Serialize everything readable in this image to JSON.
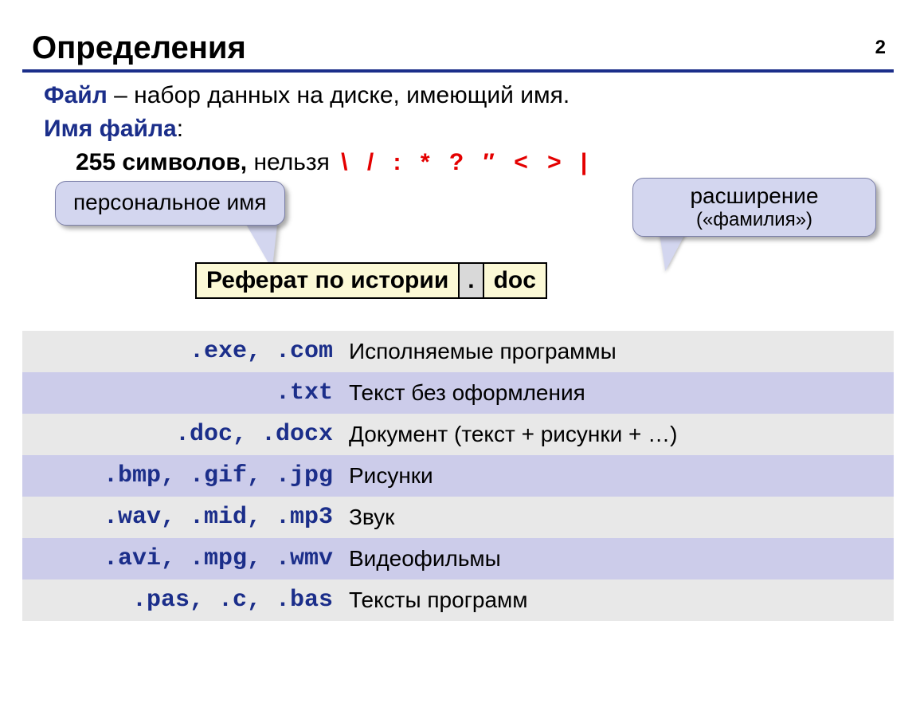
{
  "pageNumber": "2",
  "title": "Определения",
  "def": {
    "term1": "Файл",
    "text1": " – набор данных на диске, имеющий имя.",
    "term2": "Имя файла",
    "colon": ":",
    "limit": "255 символов,",
    "forbiddenLabel": " нельзя ",
    "forbiddenChars": "\\ / : * ? ″ < > |"
  },
  "callouts": {
    "left": "персональное имя",
    "rightTop": "расширение",
    "rightSub": "(«фамилия»)"
  },
  "filename": {
    "name": "Реферат по истории",
    "dot": ".",
    "ext": "doc"
  },
  "extTable": [
    {
      "ext": ".exe, .com",
      "desc": "Исполняемые программы",
      "cls": "row-grey"
    },
    {
      "ext": ".txt",
      "desc": "Текст без оформления",
      "cls": "row-lilac"
    },
    {
      "ext": ".doc, .docx",
      "desc": "Документ (текст + рисунки + …)",
      "cls": "row-grey"
    },
    {
      "ext": ".bmp, .gif, .jpg",
      "desc": "Рисунки",
      "cls": "row-lilac"
    },
    {
      "ext": ".wav, .mid, .mp3",
      "desc": "Звук",
      "cls": "row-grey"
    },
    {
      "ext": ".avi, .mpg, .wmv",
      "desc": "Видеофильмы",
      "cls": "row-lilac"
    },
    {
      "ext": ".pas, .c, .bas",
      "desc": "Тексты программ",
      "cls": "row-grey"
    }
  ]
}
